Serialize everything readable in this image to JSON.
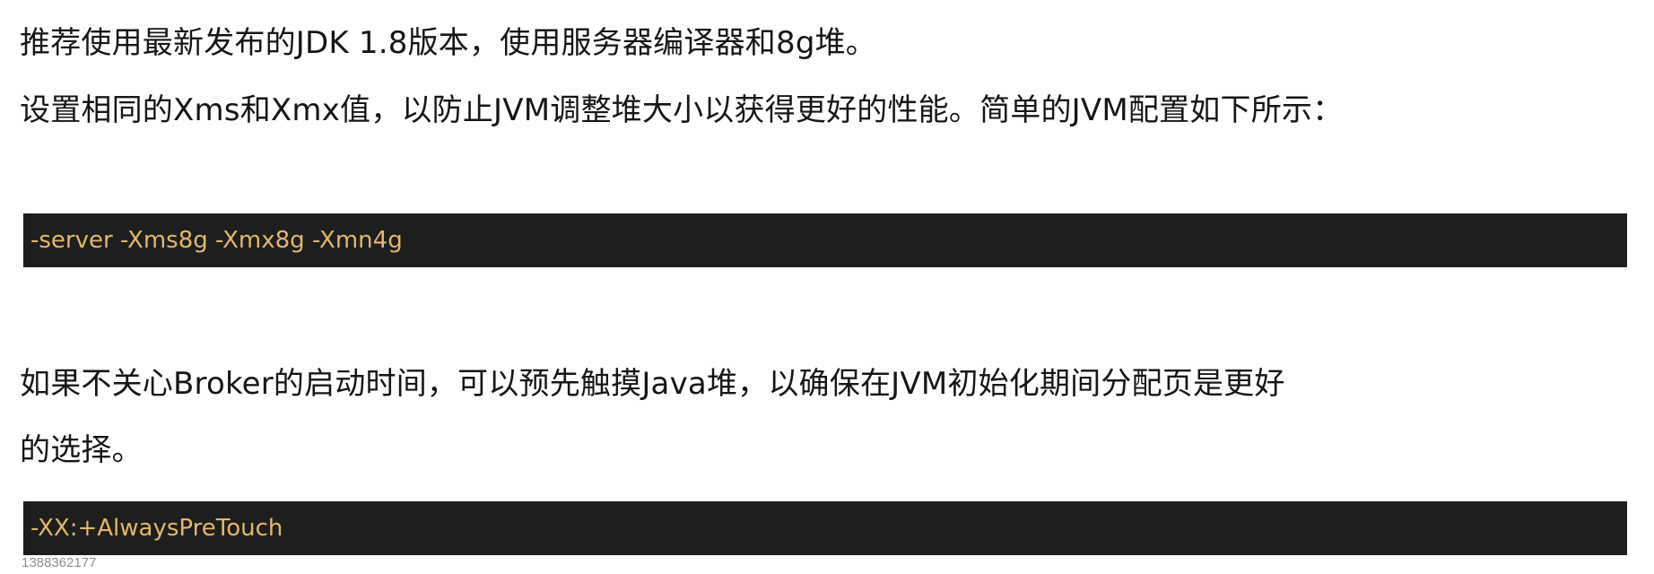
{
  "paragraphs": {
    "line1": "推荐使用最新发布的JDK 1.8版本，使用服务器编译器和8g堆。",
    "line2": "设置相同的Xms和Xmx值，以防止JVM调整堆大小以获得更好的性能。简单的JVM配置如下所示：",
    "line3": "如果不关心Broker的启动时间，可以预先触摸Java堆，以确保在JVM初始化期间分配页是更好",
    "line4": "的选择。"
  },
  "code_blocks": {
    "jvm_config": "-server -Xms8g -Xmx8g -Xmn4g",
    "pretouch": "-XX:+AlwaysPreTouch"
  },
  "watermark": "1388362177",
  "colors": {
    "code_background": "#1e1e1e",
    "code_text": "#e3b76a",
    "body_text": "#161616"
  }
}
